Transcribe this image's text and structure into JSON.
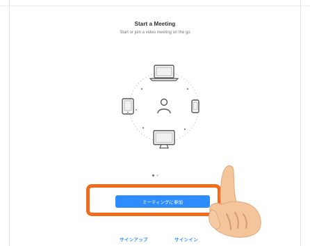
{
  "header": {
    "title": "Start a Meeting",
    "subtitle": "Start or join a video meeting on the go"
  },
  "illustration": {
    "icons": [
      "laptop-icon",
      "tablet-icon",
      "phone-icon",
      "user-icon",
      "monitor-icon"
    ]
  },
  "pagination": {
    "total": 2,
    "active": 1
  },
  "actions": {
    "join_button_label": "ミーティングに参加",
    "signup_label": "サインアップ",
    "signin_label": "サインイン"
  },
  "annotation": {
    "highlight_color": "#f26b1d",
    "hand": "pointing-hand-icon"
  },
  "colors": {
    "accent": "#2d8cff",
    "background": "#ffffff"
  }
}
